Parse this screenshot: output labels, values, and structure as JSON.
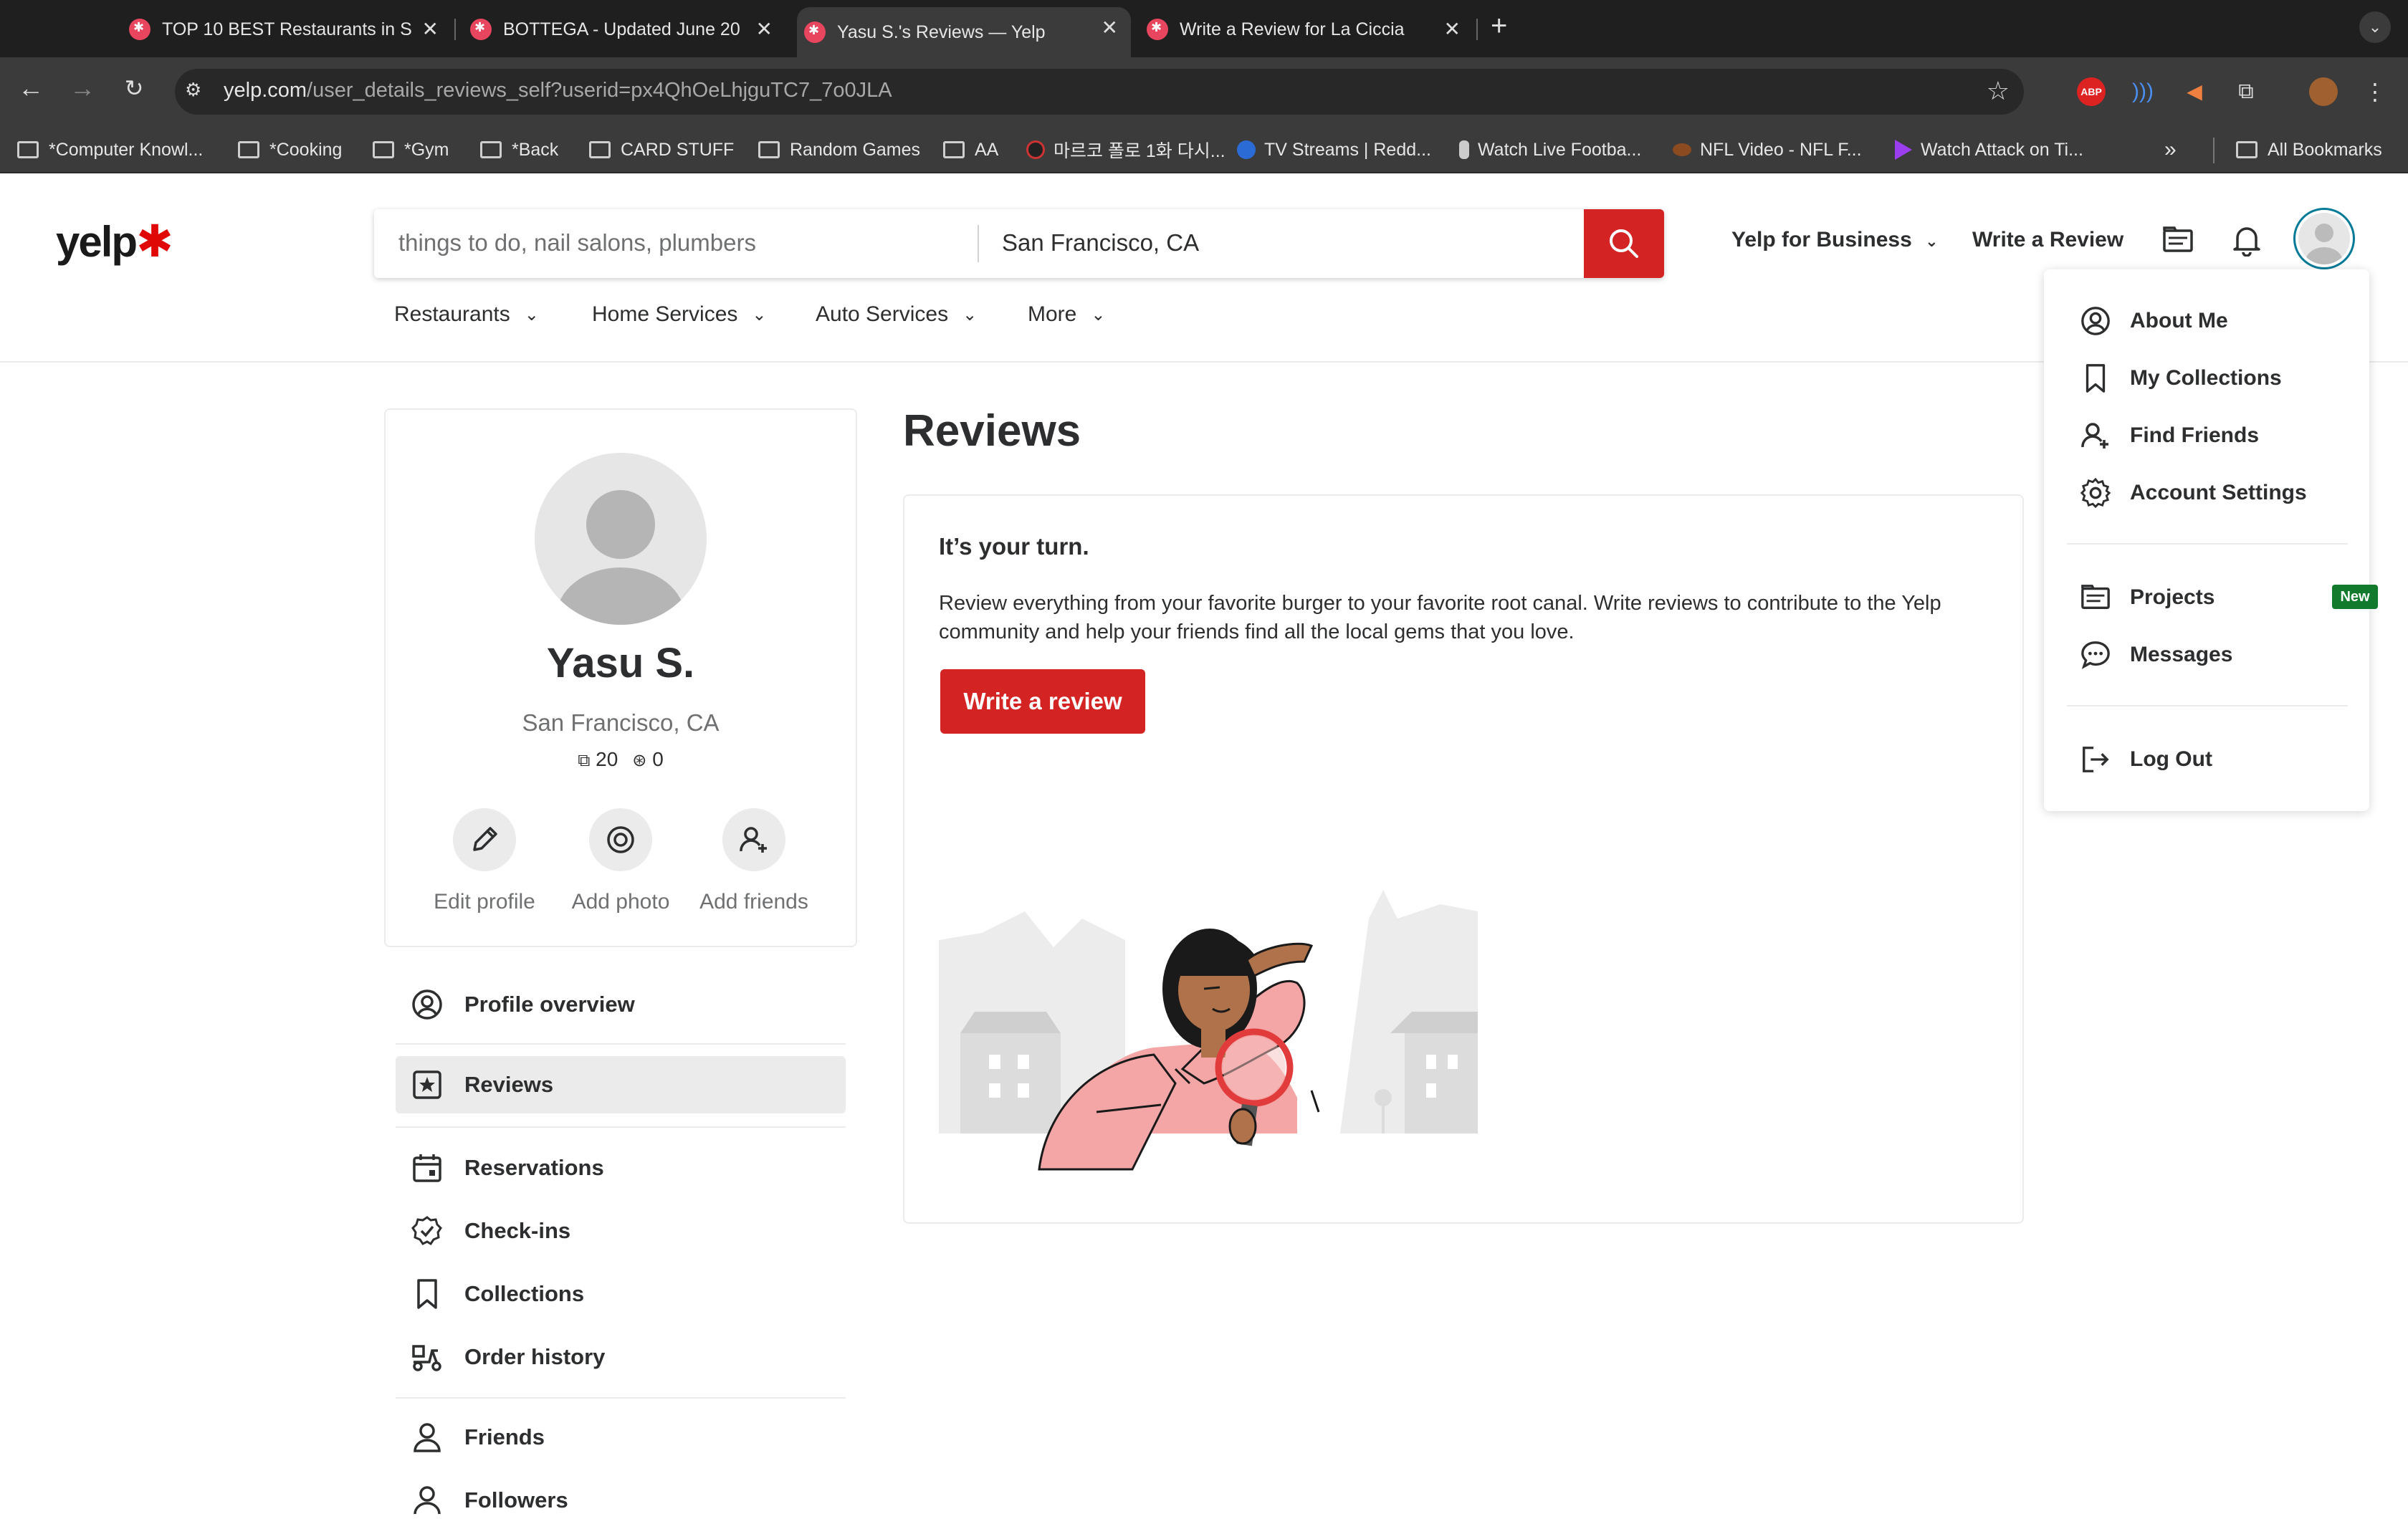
{
  "browser": {
    "tabs": [
      {
        "title": "TOP 10 BEST Restaurants in S"
      },
      {
        "title": "BOTTEGA - Updated June 20"
      },
      {
        "title": "Yasu S.'s Reviews — Yelp"
      },
      {
        "title": "Write a Review for La Ciccia"
      }
    ],
    "url_domain": "yelp.com",
    "url_path": "/user_details_reviews_self?userid=px4QhOeLhjguTC7_7o0JLA",
    "bookmarks": [
      "*Computer Knowl...",
      "*Cooking",
      "*Gym",
      "*Back",
      "CARD STUFF",
      "Random Games",
      "AA",
      "마르코 폴로 1화 다시...",
      "TV Streams | Redd...",
      "Watch Live Footba...",
      "NFL Video - NFL F...",
      "Watch Attack on Ti...",
      "All Bookmarks"
    ],
    "extensions": {
      "abp": "ABP"
    }
  },
  "header": {
    "logo": "yelp",
    "search_placeholder": "things to do, nail salons, plumbers",
    "location_value": "San Francisco, CA",
    "yelp_for_business": "Yelp for Business",
    "write_review": "Write a Review",
    "categories": [
      "Restaurants",
      "Home Services",
      "Auto Services",
      "More"
    ]
  },
  "profile": {
    "name": "Yasu S.",
    "location": "San Francisco, CA",
    "friends_count": "20",
    "reviews_count": "0",
    "actions": [
      "Edit profile",
      "Add photo",
      "Add friends"
    ]
  },
  "sidebar": {
    "items": [
      "Profile overview",
      "Reviews",
      "Reservations",
      "Check-ins",
      "Collections",
      "Order history",
      "Friends",
      "Followers"
    ]
  },
  "main": {
    "heading": "Reviews",
    "card_title": "It’s your turn.",
    "card_text": "Review everything from your favorite burger to your favorite root canal. Write reviews to contribute to the Yelp community and help your friends find all the local gems that you love.",
    "card_button": "Write a review"
  },
  "dropdown": {
    "items": [
      "About Me",
      "My Collections",
      "Find Friends",
      "Account Settings",
      "Projects",
      "Messages",
      "Log Out"
    ],
    "badge": "New"
  },
  "colors": {
    "brand": "#d32323",
    "badge": "#117a2d",
    "focus_ring": "#027a97"
  }
}
